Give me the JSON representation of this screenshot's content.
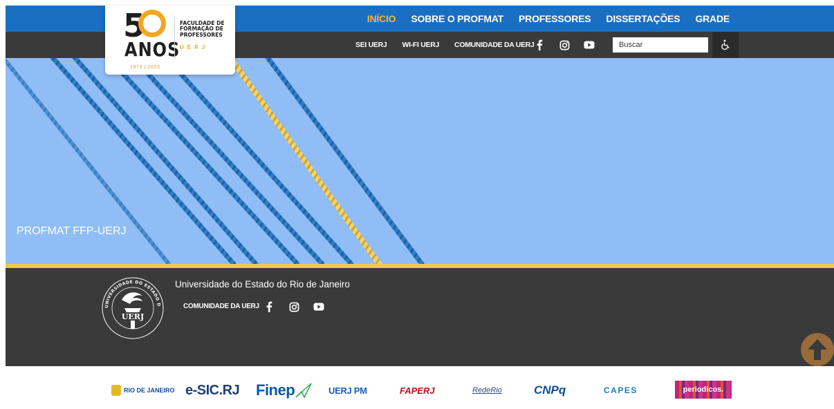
{
  "logo": {
    "fifty": "5",
    "anos": "ANOS",
    "years": "1973 | 2023",
    "faculty_line1": "FACULDADE DE",
    "faculty_line2": "FORMAÇÃO DE",
    "faculty_line3": "PROFESSORES",
    "uerj": "UERJ"
  },
  "topnav": {
    "items": [
      {
        "label": "INÍCIO",
        "active": true
      },
      {
        "label": "SOBRE O PROFMAT",
        "active": false
      },
      {
        "label": "PROFESSORES",
        "active": false
      },
      {
        "label": "DISSERTAÇÕES",
        "active": false
      },
      {
        "label": "GRADE",
        "active": false
      }
    ]
  },
  "subnav": {
    "links": [
      "SEI UERJ",
      "WI-FI UERJ",
      "COMUNIDADE DA UERJ"
    ],
    "search_placeholder": "Buscar",
    "social_icons": [
      "facebook-icon",
      "instagram-icon",
      "youtube-icon"
    ],
    "accessibility_icon": "wheelchair-icon"
  },
  "hero": {
    "caption": "PROFMAT FFP-UERJ",
    "background_color": "#90bdf6"
  },
  "footer": {
    "university": "Universidade do Estado do Rio de Janeiro",
    "community": "COMUNIDADE DA UERJ",
    "seal_text": "UERJ",
    "seal_ring_text": "UNIVERSIDADE DO ESTADO DO RIO DE JANEIRO",
    "back_to_top_icon": "arrow-up-icon"
  },
  "partners": {
    "rj": "RIO DE JANEIRO",
    "esic": "e-SIC.RJ",
    "finep": "Finep",
    "uerjpm": "UERJ PM",
    "faperj": "FAPERJ",
    "rederio": "RedeRio",
    "cnpq": "CNPq",
    "capes": "CAPES",
    "periodicos": "periodicos."
  },
  "colors": {
    "nav_blue": "#1a6fc2",
    "nav_active": "#f5b731",
    "dark_bar": "#3a3a3a",
    "gold": "#f0c84c"
  }
}
